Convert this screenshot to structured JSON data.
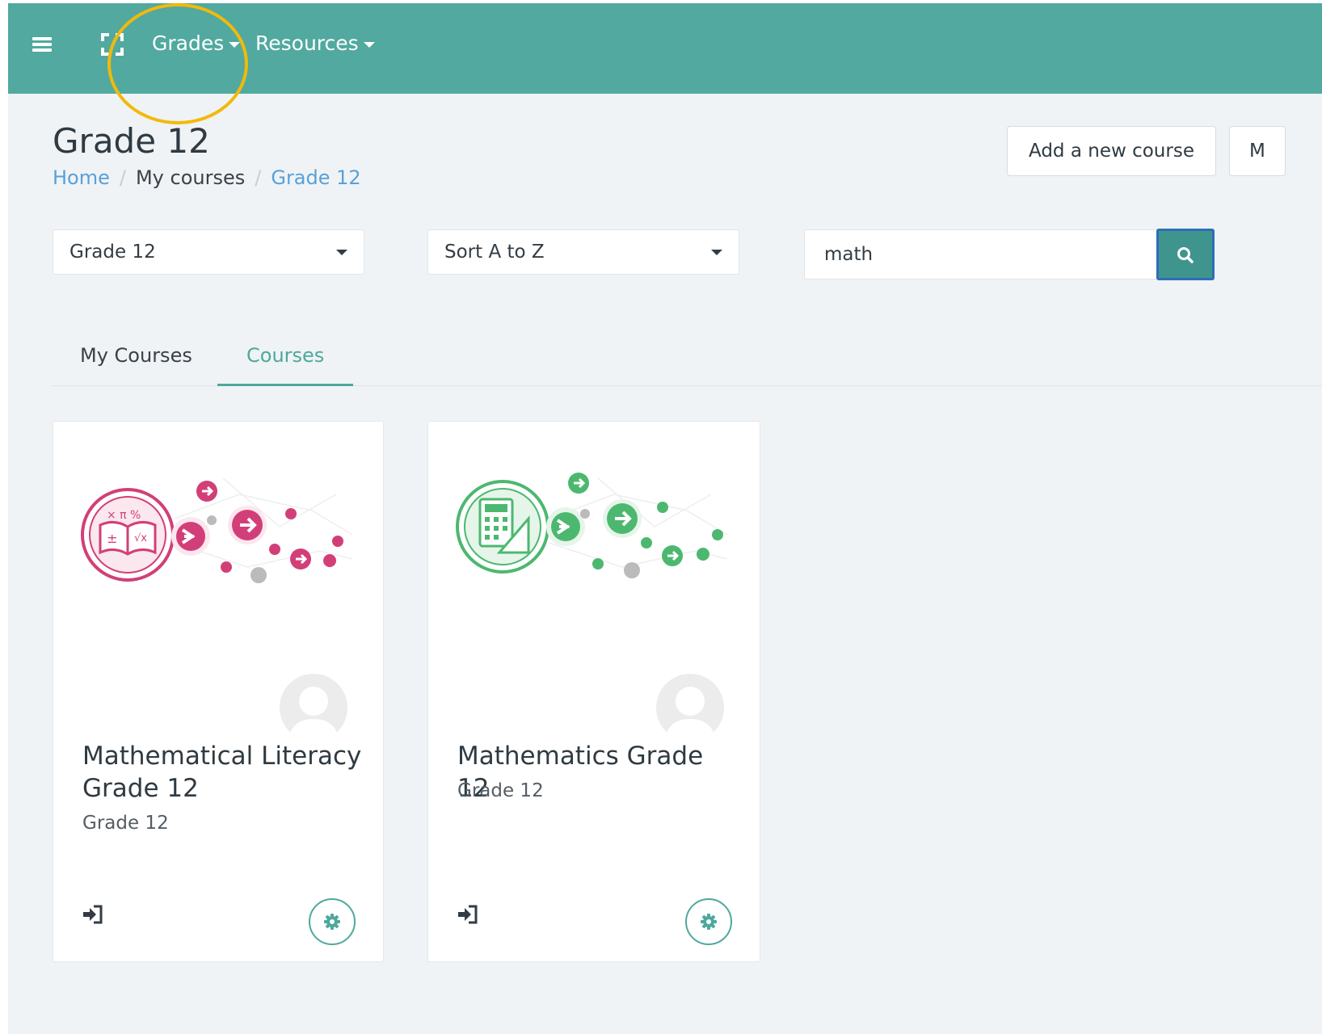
{
  "navbar": {
    "menu_items": [
      {
        "label": "Grades"
      },
      {
        "label": "Resources"
      }
    ]
  },
  "header": {
    "title": "Grade 12",
    "breadcrumb": [
      {
        "label": "Home"
      },
      {
        "label": "My courses"
      },
      {
        "label": "Grade 12"
      }
    ],
    "buttons": [
      {
        "label": "Add a new course"
      },
      {
        "label": "M"
      }
    ]
  },
  "filters": {
    "category_select": {
      "value": "Grade 12"
    },
    "sort_select": {
      "value": "Sort A to Z"
    },
    "search": {
      "value": "math"
    }
  },
  "tabs": [
    {
      "label": "My Courses",
      "active": false
    },
    {
      "label": "Courses",
      "active": true
    }
  ],
  "courses": [
    {
      "title": "Mathematical Literacy Grade 12",
      "category": "Grade 12",
      "accent": "#d23f78",
      "icon": "open-book-math-icon"
    },
    {
      "title": "Mathematics Grade 12",
      "category": "Grade 12",
      "accent": "#4cb86f",
      "icon": "calculator-ruler-icon"
    }
  ],
  "colors": {
    "navbar": "#51a9a0",
    "accent": "#4ea89d",
    "link": "#5aa0d8",
    "highlight": "#f2b90c"
  }
}
